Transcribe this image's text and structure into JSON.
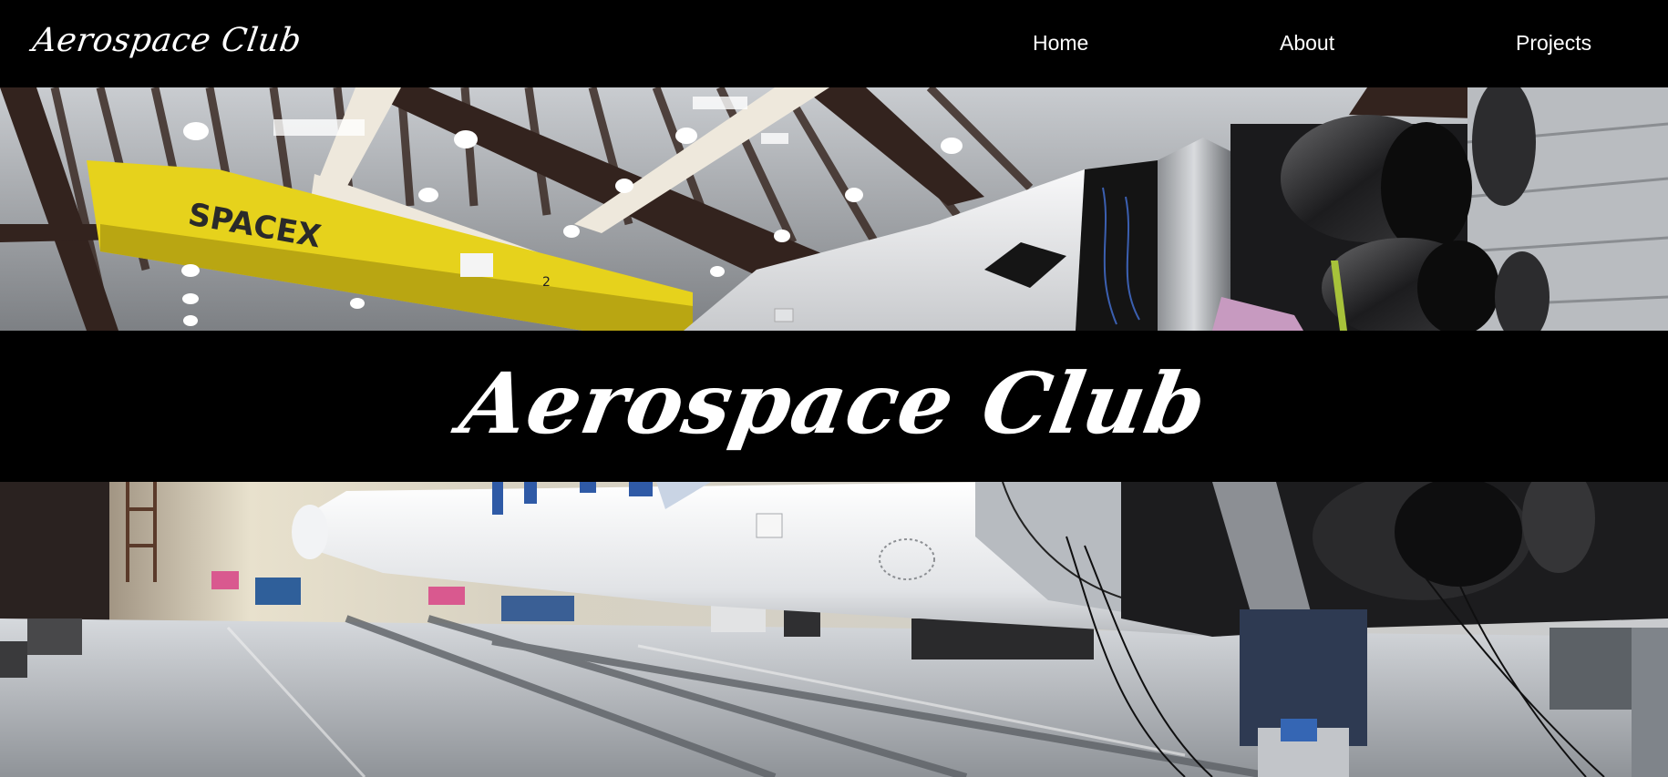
{
  "nav": {
    "logo": "Aerospace Club",
    "links": [
      {
        "label": "Home"
      },
      {
        "label": "About"
      },
      {
        "label": "Projects"
      }
    ]
  },
  "hero": {
    "title": "Aerospace Club",
    "banner_text": "SPACEX",
    "crane_number": "2"
  },
  "colors": {
    "background": "#000000",
    "text": "#ffffff",
    "crane_yellow": "#e6d21c",
    "rocket_white": "#f1f2f4"
  }
}
